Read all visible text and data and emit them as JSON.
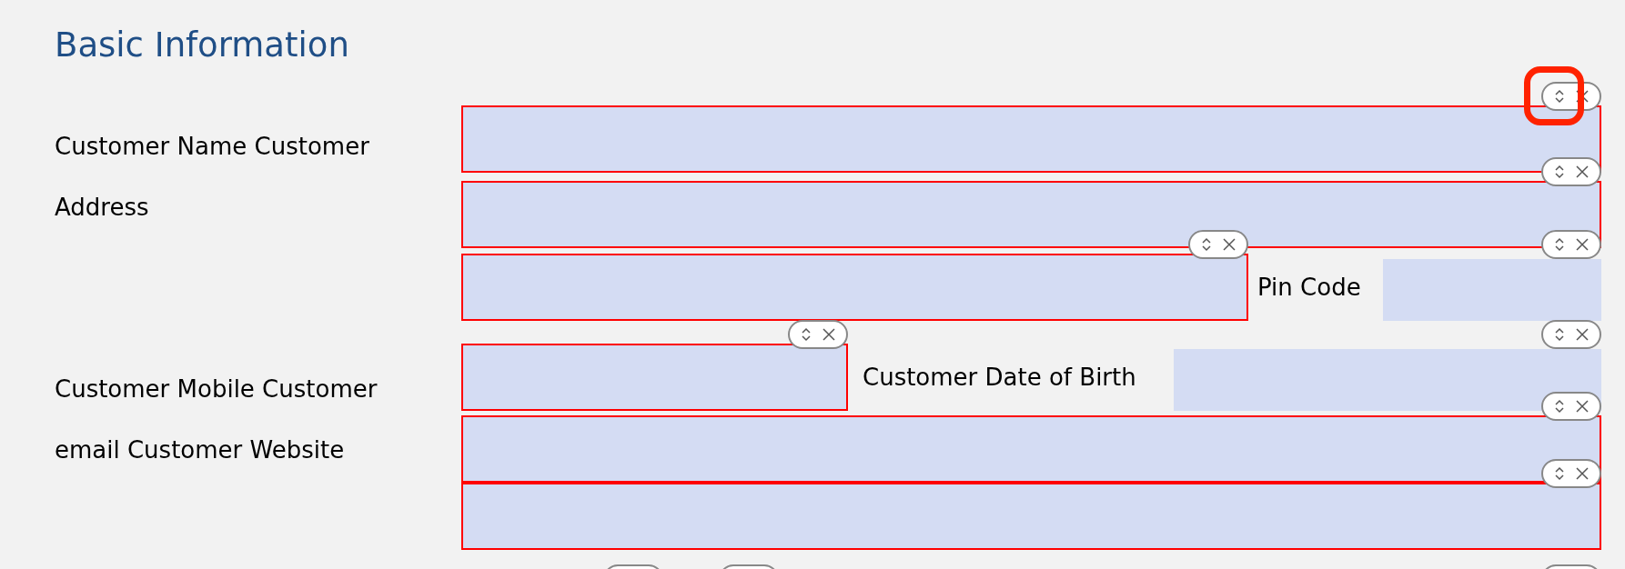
{
  "heading": "Basic Information",
  "label_groups": [
    {
      "lines": [
        "Customer Name Customer",
        "Address"
      ]
    },
    {
      "lines": [
        "Customer Mobile  Customer",
        "email Customer Website"
      ]
    }
  ],
  "rows": [
    [
      {
        "kind": "field",
        "framed": true,
        "highlighted": true
      }
    ],
    [
      {
        "kind": "field",
        "framed": true,
        "highlighted": false
      }
    ],
    [
      {
        "kind": "field",
        "framed": true,
        "highlighted": false
      },
      {
        "kind": "label",
        "text": "Pin Code"
      },
      {
        "kind": "field",
        "framed": false,
        "highlighted": false
      }
    ],
    [
      {
        "kind": "field",
        "framed": true,
        "highlighted": false
      },
      {
        "kind": "label",
        "text": "Customer Date of Birth"
      },
      {
        "kind": "field",
        "framed": false,
        "highlighted": false
      }
    ],
    [
      {
        "kind": "field",
        "framed": true,
        "highlighted": false
      }
    ],
    [
      {
        "kind": "field",
        "framed": true,
        "highlighted": false
      }
    ]
  ],
  "trailing_handles": [
    {
      "highlighted": false
    },
    {
      "highlighted": false
    },
    {
      "highlighted": false
    }
  ]
}
